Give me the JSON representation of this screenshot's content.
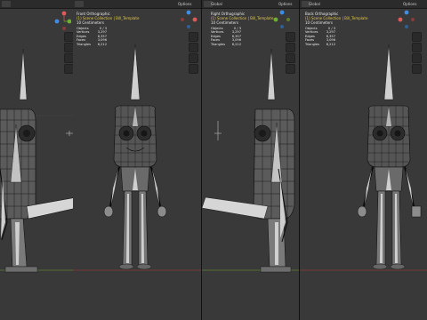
{
  "viewports": [
    {
      "id": "vp1",
      "header": {
        "mode": "",
        "view": "",
        "select": "",
        "add": "",
        "object": "",
        "global": "",
        "options": ""
      },
      "overlay": {
        "title": "",
        "collection": "",
        "units": ""
      },
      "stats": [],
      "view": "side-left"
    },
    {
      "id": "vp2",
      "header": {
        "mode": "",
        "view": "",
        "select": "",
        "add": "",
        "object": "",
        "global": "",
        "options": "Options"
      },
      "overlay": {
        "title": "Front Orthographic",
        "collection": "(1) Scene Collection | Bill_Template",
        "units": "10 Centimeters"
      },
      "stats": [
        {
          "label": "Objects",
          "value": "0 / 3"
        },
        {
          "label": "Vertices",
          "value": "3,297"
        },
        {
          "label": "Edges",
          "value": "6,357"
        },
        {
          "label": "Faces",
          "value": "3,096"
        },
        {
          "label": "Triangles",
          "value": "6,212"
        }
      ],
      "view": "front"
    },
    {
      "id": "vp3",
      "header": {
        "mode": "",
        "view": "",
        "select": "",
        "add": "",
        "object": "",
        "global": "Global",
        "options": "Options"
      },
      "overlay": {
        "title": "Right Orthographic",
        "collection": "(1) Scene Collection | Bill_Template",
        "units": "10 Centimeters"
      },
      "stats": [
        {
          "label": "Objects",
          "value": "0 / 3"
        },
        {
          "label": "Vertices",
          "value": "3,297"
        },
        {
          "label": "Edges",
          "value": "6,357"
        },
        {
          "label": "Faces",
          "value": "3,096"
        },
        {
          "label": "Triangles",
          "value": "6,212"
        }
      ],
      "view": "side-right"
    },
    {
      "id": "vp4",
      "header": {
        "mode": "",
        "view": "",
        "select": "",
        "add": "",
        "object": "",
        "global": "Global",
        "options": "Options"
      },
      "overlay": {
        "title": "Back Orthographic",
        "collection": "(1) Scene Collection | Bill_Template",
        "units": "10 Centimeters"
      },
      "stats": [
        {
          "label": "Objects",
          "value": "0 / 3"
        },
        {
          "label": "Vertices",
          "value": "3,297"
        },
        {
          "label": "Edges",
          "value": "6,357"
        },
        {
          "label": "Faces",
          "value": "3,096"
        },
        {
          "label": "Triangles",
          "value": "6,212"
        }
      ],
      "view": "back"
    }
  ],
  "colors": {
    "viewport_bg": "#393939",
    "header_bg": "#2b2b2b",
    "grid_x": "#8b3a3a",
    "grid_y": "#5e7f2c",
    "wire": "#0b0b0b",
    "bone": "#cfcfcf",
    "collection": "#e4c84a"
  }
}
